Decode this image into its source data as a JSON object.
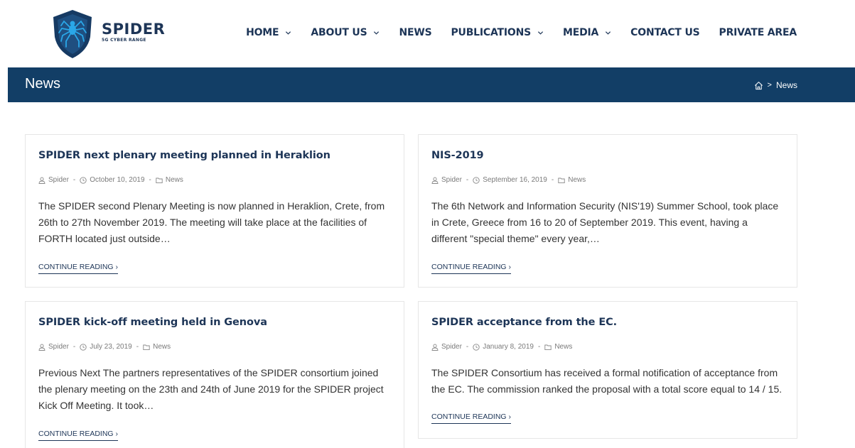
{
  "header": {
    "logo_title": "SPIDER",
    "logo_subtitle": "5G CYBER RANGE",
    "nav": [
      {
        "label": "HOME",
        "has_dropdown": true
      },
      {
        "label": "ABOUT US",
        "has_dropdown": true
      },
      {
        "label": "NEWS",
        "has_dropdown": false
      },
      {
        "label": "PUBLICATIONS",
        "has_dropdown": true
      },
      {
        "label": "MEDIA",
        "has_dropdown": true
      },
      {
        "label": "CONTACT US",
        "has_dropdown": false
      },
      {
        "label": "PRIVATE AREA",
        "has_dropdown": false
      }
    ]
  },
  "titlebar": {
    "title": "News",
    "breadcrumb_sep": ">",
    "breadcrumb_current": "News"
  },
  "posts": [
    {
      "title": "SPIDER next plenary meeting planned in Heraklion",
      "author": "Spider",
      "date": "October 10, 2019",
      "category": "News",
      "excerpt": [
        "The SPIDER second Plenary Meeting is now planned in Heraklion, Crete, from",
        "26th to 27th November 2019. The meeting will take place at the facilities of",
        "FORTH located just outside…"
      ],
      "more": "CONTINUE READING ›"
    },
    {
      "title": "NIS-2019",
      "author": "Spider",
      "date": "September 16, 2019",
      "category": "News",
      "excerpt": [
        "The 6th Network and Information Security (NIS'19) Summer School, took place",
        "in Crete, Greece from 16 to 20 of September 2019. This event, having a",
        "different \"special theme\" every year,…"
      ],
      "more": "CONTINUE READING ›"
    },
    {
      "title": "SPIDER kick-off meeting held in Genova",
      "author": "Spider",
      "date": "July 23, 2019",
      "category": "News",
      "excerpt": [
        "Previous Next The partners representatives of the SPIDER consortium joined",
        "the plenary meeting on the 23th and 24th of June 2019 for the SPIDER project",
        "Kick Off Meeting. It took…"
      ],
      "more": "CONTINUE READING ›"
    },
    {
      "title": "SPIDER acceptance from the EC.",
      "author": "Spider",
      "date": "January 8, 2019",
      "category": "News",
      "excerpt": [
        "The SPIDER Consortium has received a formal notification of acceptance from",
        "the EC. The commission ranked the proposal with a total score equal to 14 / 15."
      ],
      "more": "CONTINUE READING ›"
    }
  ],
  "colors": {
    "brand": "#1d3557",
    "titlebar": "#123e66",
    "meta": "#7a7a7a"
  }
}
